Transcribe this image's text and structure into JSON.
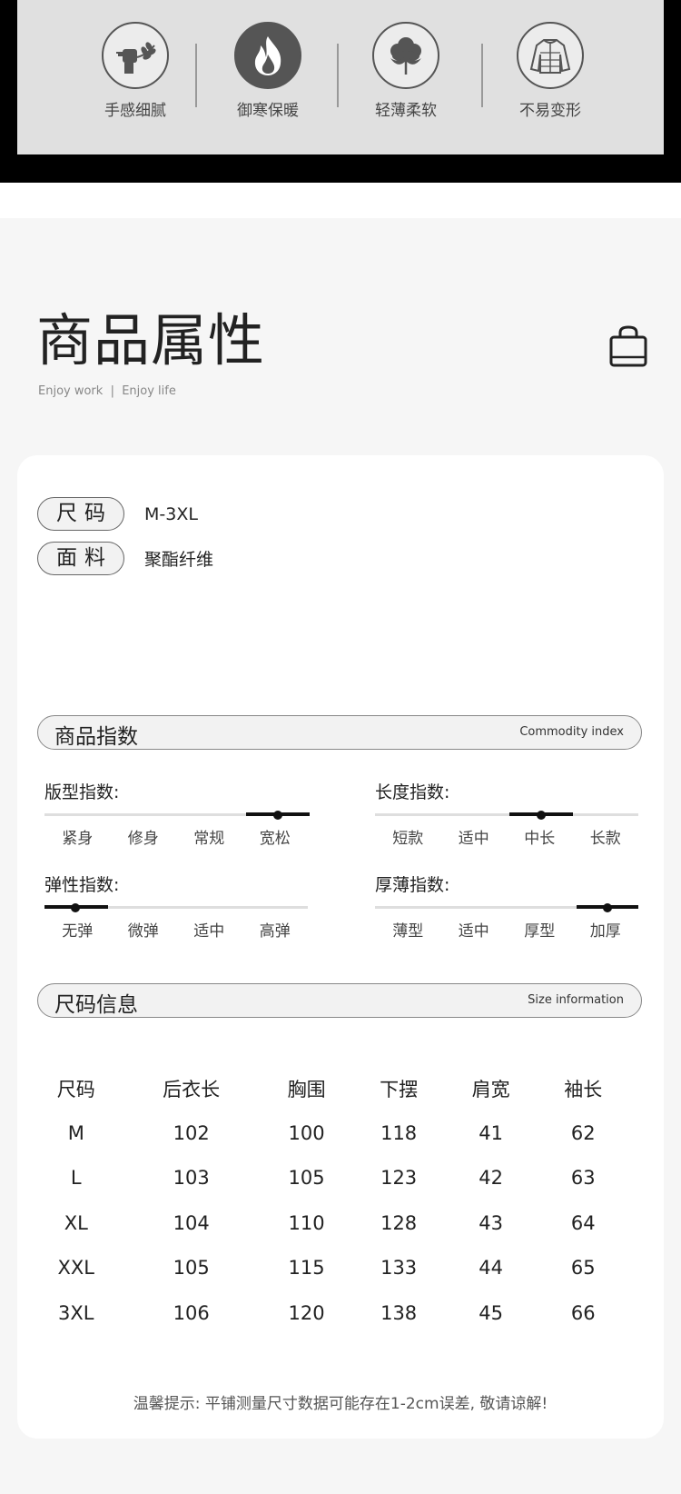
{
  "features": [
    {
      "label": "手感细腻",
      "icon": "hand-wheat-icon"
    },
    {
      "label": "御寒保暖",
      "icon": "flame-icon"
    },
    {
      "label": "轻薄柔软",
      "icon": "cotton-icon"
    },
    {
      "label": "不易变形",
      "icon": "jacket-icon"
    }
  ],
  "header": {
    "title": "商品属性",
    "subtitle": "Enjoy work  |  Enjoy life",
    "icon": "shopping-bag-icon"
  },
  "attributes": [
    {
      "label": "尺码",
      "value": "M-3XL"
    },
    {
      "label": "面料",
      "value": "聚酯纤维"
    }
  ],
  "commodity_index": {
    "title": "商品指数",
    "title_en": "Commodity index",
    "indices": [
      {
        "title": "版型指数:",
        "options": [
          "紧身",
          "修身",
          "常规",
          "宽松"
        ],
        "selected": "宽松"
      },
      {
        "title": "长度指数:",
        "options": [
          "短款",
          "适中",
          "中长",
          "长款"
        ],
        "selected": "中长"
      },
      {
        "title": "弹性指数:",
        "options": [
          "无弹",
          "微弹",
          "适中",
          "高弹"
        ],
        "selected": "无弹"
      },
      {
        "title": "厚薄指数:",
        "options": [
          "薄型",
          "适中",
          "厚型",
          "加厚"
        ],
        "selected": "加厚"
      }
    ]
  },
  "size_info": {
    "title": "尺码信息",
    "title_en": "Size information",
    "columns": [
      "尺码",
      "后衣长",
      "胸围",
      "下摆",
      "肩宽",
      "袖长"
    ],
    "rows": [
      [
        "M",
        "102",
        "100",
        "118",
        "41",
        "62"
      ],
      [
        "L",
        "103",
        "105",
        "123",
        "42",
        "63"
      ],
      [
        "XL",
        "104",
        "110",
        "128",
        "43",
        "64"
      ],
      [
        "XXL",
        "105",
        "115",
        "133",
        "44",
        "65"
      ],
      [
        "3XL",
        "106",
        "120",
        "138",
        "45",
        "66"
      ]
    ],
    "note": "温馨提示: 平铺测量尺寸数据可能存在1-2cm误差, 敬请谅解!"
  }
}
